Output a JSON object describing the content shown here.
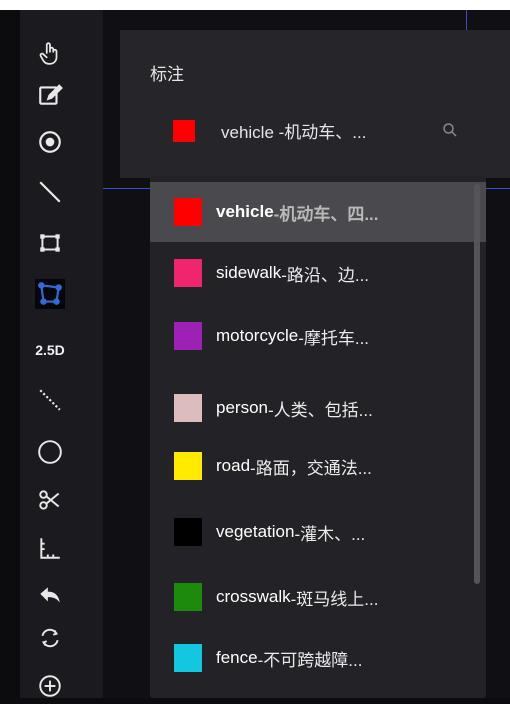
{
  "toolbar": {
    "tools": [
      {
        "icon": "hand-icon"
      },
      {
        "icon": "edit-icon"
      },
      {
        "icon": "point-icon"
      },
      {
        "icon": "line-icon"
      },
      {
        "icon": "rectangle-icon"
      },
      {
        "icon": "polygon-icon",
        "active": true
      },
      {
        "label": "2.5D"
      },
      {
        "icon": "dashed-line-icon"
      },
      {
        "icon": "circle-icon"
      },
      {
        "icon": "scissors-icon"
      },
      {
        "icon": "ruler-icon"
      },
      {
        "icon": "undo-icon"
      },
      {
        "icon": "rotate-icon"
      },
      {
        "icon": "add-circle-icon"
      }
    ],
    "label_2_5d": "2.5D"
  },
  "panel": {
    "title": "标注",
    "selected": {
      "text": "vehicle -机动车、...",
      "color": "#ff0000"
    }
  },
  "dropdown": {
    "options": [
      {
        "name": "vehicle",
        "desc": "-机动车、四...",
        "color": "#ff0000",
        "hover": true
      },
      {
        "name": "sidewalk",
        "desc": "-路沿、边...",
        "color": "#f0256e"
      },
      {
        "name": "motorcycle",
        "desc": "-摩托车...",
        "color": "#9b22b4"
      },
      {
        "name": "person",
        "desc": "-人类、包括...",
        "color": "#dcbcbd"
      },
      {
        "name": "road",
        "desc": "-路面，交通法...",
        "color": "#ffea00"
      },
      {
        "name": "vegetation",
        "desc": "-灌木、...",
        "color": "#000000"
      },
      {
        "name": "crosswalk",
        "desc": "-斑马线上...",
        "color": "#1d8a0e"
      },
      {
        "name": "fence",
        "desc": "-不可跨越障...",
        "color": "#14c7e1"
      }
    ]
  }
}
